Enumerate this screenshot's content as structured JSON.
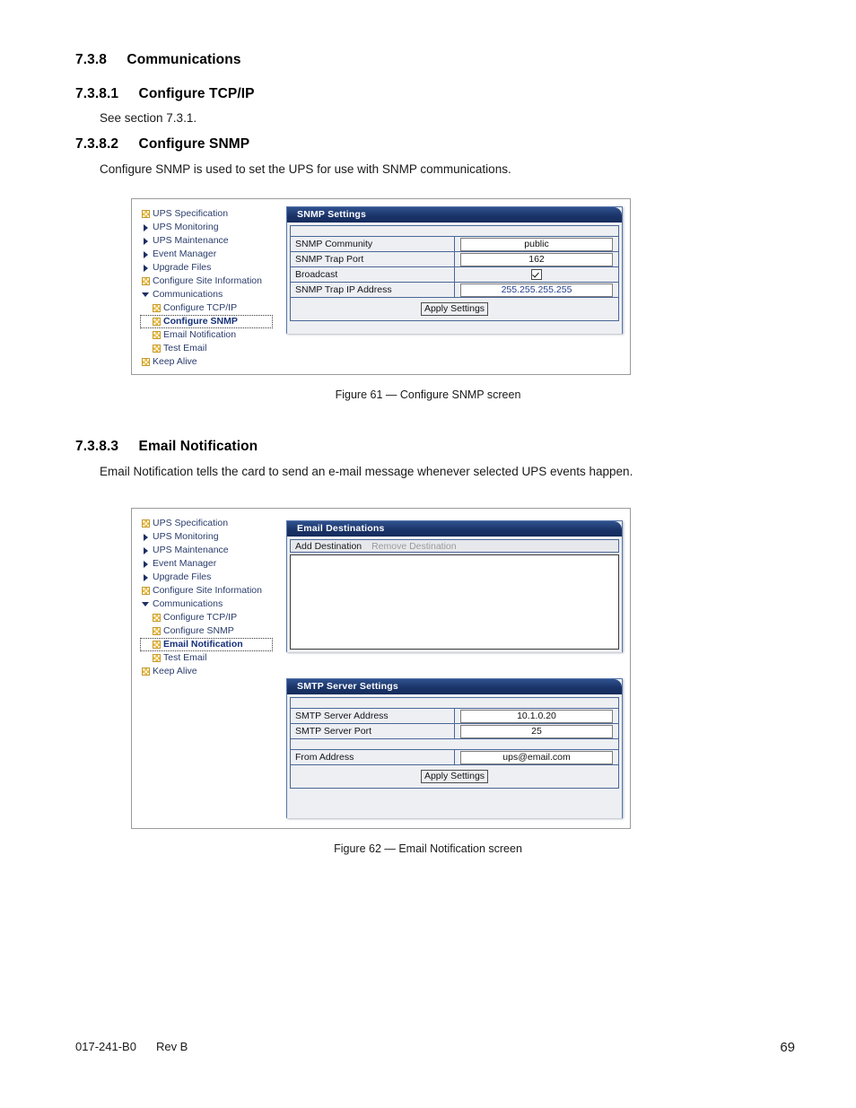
{
  "document": {
    "sections": [
      {
        "number": "7.3.8",
        "title": "Communications"
      },
      {
        "number": "7.3.8.1",
        "title": "Configure TCP/IP"
      },
      {
        "number": "7.3.8.2",
        "title": "Configure SNMP"
      },
      {
        "number": "7.3.8.3",
        "title": "Email Notification"
      }
    ],
    "paragraphs": {
      "tcpip": "See section 7.3.1.",
      "snmp": "Configure SNMP is used to set the UPS for use with SNMP communications.",
      "email": "Email Notification tells the card to send an e-mail message whenever selected UPS events happen."
    },
    "captions": {
      "figure61": "Figure 61  —  Configure SNMP screen",
      "figure62": "Figure 62  —  Email Notification screen"
    },
    "footer": {
      "doc_number": "017-241-B0",
      "revision": "Rev B",
      "page_number": "69"
    }
  },
  "figure61": {
    "tree": [
      {
        "label": "UPS Specification",
        "icon": "broken-image-icon",
        "level": 1,
        "selected": false
      },
      {
        "label": "UPS Monitoring",
        "icon": "triangle-right-icon",
        "level": 1,
        "selected": false
      },
      {
        "label": "UPS Maintenance",
        "icon": "triangle-right-icon",
        "level": 1,
        "selected": false
      },
      {
        "label": "Event Manager",
        "icon": "triangle-right-icon",
        "level": 1,
        "selected": false
      },
      {
        "label": "Upgrade Files",
        "icon": "triangle-right-icon",
        "level": 1,
        "selected": false
      },
      {
        "label": "Configure Site Information",
        "icon": "broken-image-icon",
        "level": 1,
        "selected": false
      },
      {
        "label": "Communications",
        "icon": "triangle-down-icon",
        "level": 1,
        "selected": false
      },
      {
        "label": "Configure TCP/IP",
        "icon": "broken-image-icon",
        "level": 2,
        "selected": false
      },
      {
        "label": "Configure SNMP",
        "icon": "broken-image-icon",
        "level": 2,
        "selected": true
      },
      {
        "label": "Email Notification",
        "icon": "broken-image-icon",
        "level": 2,
        "selected": false
      },
      {
        "label": "Test Email",
        "icon": "broken-image-icon",
        "level": 2,
        "selected": false
      },
      {
        "label": "Keep Alive",
        "icon": "broken-image-icon",
        "level": 1,
        "selected": false
      }
    ],
    "panel": {
      "title": "SNMP Settings",
      "rows": [
        {
          "label": "SNMP Community",
          "value": "public",
          "type": "text"
        },
        {
          "label": "SNMP Trap Port",
          "value": "162",
          "type": "text"
        },
        {
          "label": "Broadcast",
          "value": "checked",
          "type": "checkbox"
        },
        {
          "label": "SNMP Trap IP Address",
          "value": "255.255.255.255",
          "type": "text-blue"
        }
      ],
      "apply_label": "Apply Settings"
    }
  },
  "figure62": {
    "tree": [
      {
        "label": "UPS Specification",
        "icon": "broken-image-icon",
        "level": 1,
        "selected": false
      },
      {
        "label": "UPS Monitoring",
        "icon": "triangle-right-icon",
        "level": 1,
        "selected": false
      },
      {
        "label": "UPS Maintenance",
        "icon": "triangle-right-icon",
        "level": 1,
        "selected": false
      },
      {
        "label": "Event Manager",
        "icon": "triangle-right-icon",
        "level": 1,
        "selected": false
      },
      {
        "label": "Upgrade Files",
        "icon": "triangle-right-icon",
        "level": 1,
        "selected": false
      },
      {
        "label": "Configure Site Information",
        "icon": "broken-image-icon",
        "level": 1,
        "selected": false
      },
      {
        "label": "Communications",
        "icon": "triangle-down-icon",
        "level": 1,
        "selected": false
      },
      {
        "label": "Configure TCP/IP",
        "icon": "broken-image-icon",
        "level": 2,
        "selected": false
      },
      {
        "label": "Configure SNMP",
        "icon": "broken-image-icon",
        "level": 2,
        "selected": false
      },
      {
        "label": "Email Notification",
        "icon": "broken-image-icon",
        "level": 2,
        "selected": true
      },
      {
        "label": "Test Email",
        "icon": "broken-image-icon",
        "level": 2,
        "selected": false
      },
      {
        "label": "Keep Alive",
        "icon": "broken-image-icon",
        "level": 1,
        "selected": false
      }
    ],
    "destinations_panel": {
      "title": "Email Destinations",
      "add_label": "Add Destination",
      "remove_label": "Remove Destination",
      "list_items": []
    },
    "smtp_panel": {
      "title": "SMTP Server Settings",
      "rows": [
        {
          "label": "SMTP Server Address",
          "value": "10.1.0.20",
          "type": "text"
        },
        {
          "label": "SMTP Server Port",
          "value": "25",
          "type": "text"
        },
        {
          "label": "From Address",
          "value": "ups@email.com",
          "type": "text"
        }
      ],
      "apply_label": "Apply Settings"
    }
  },
  "colors": {
    "panel_header_blue": "#1b3469",
    "panel_border_blue": "#4a6799",
    "tree_text_blue": "#2a3c6b",
    "tree_selected_blue": "#14307a",
    "field_value_blue": "#25408f",
    "icon_yellow": "#e8b83c",
    "panel_body_grey": "#edeff2"
  }
}
